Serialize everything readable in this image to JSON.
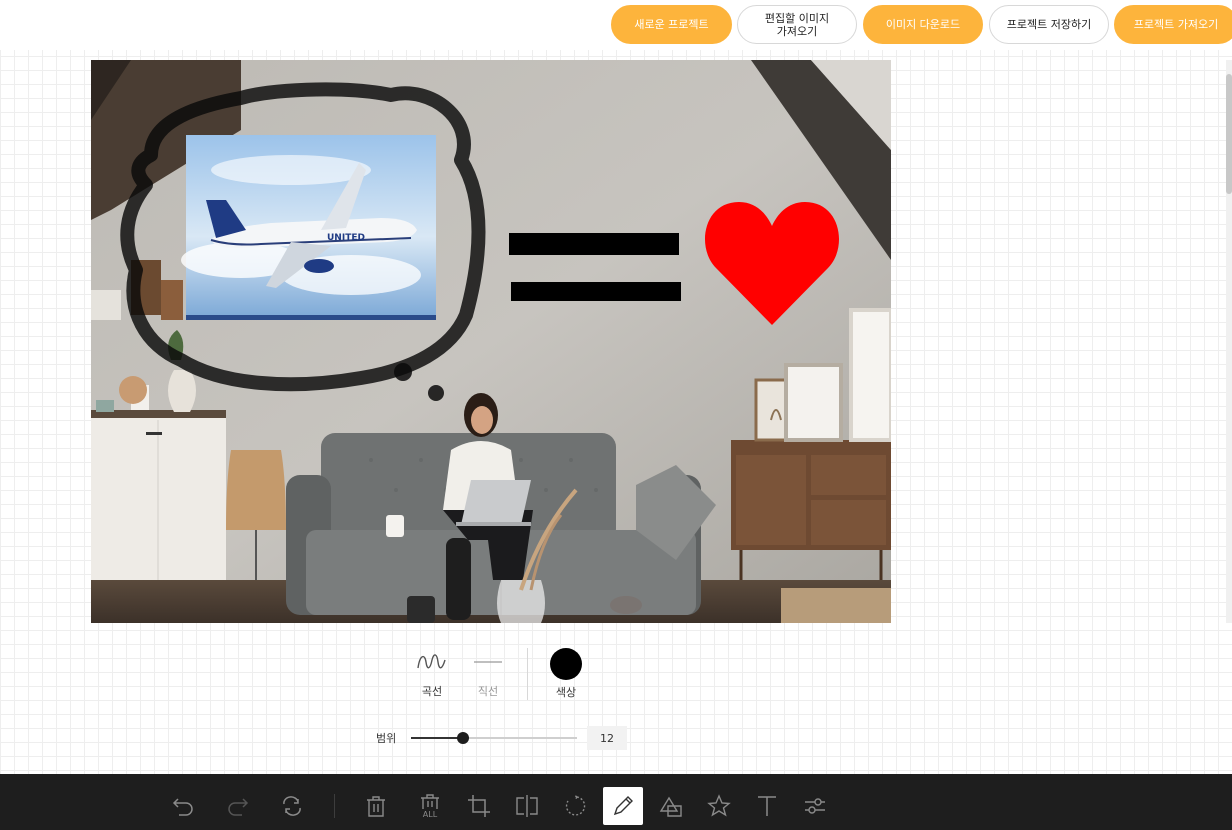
{
  "header": {
    "buttons": [
      {
        "label": "새로운 프로젝트",
        "style": "primary"
      },
      {
        "label": "편집할 이미지\n가져오기",
        "style": "secondary"
      },
      {
        "label": "이미지 다운로드",
        "style": "primary"
      },
      {
        "label": "프로젝트 저장하기",
        "style": "secondary"
      },
      {
        "label": "프로젝트 가져오기",
        "style": "primary"
      }
    ]
  },
  "canvas": {
    "airplane_logo_text": "UNITED",
    "equals_sign": "=",
    "heart_color": "#ff0000"
  },
  "draw_menu": {
    "free_label": "곡선",
    "line_label": "직선",
    "color_label": "색상",
    "selected_color": "#000000",
    "range_label": "범위",
    "range_value": "12",
    "range_fraction": 0.3
  },
  "toolbar": {
    "tools": [
      "undo-icon",
      "redo-icon",
      "reset-icon",
      "delete-icon",
      "delete-all-icon",
      "crop-icon",
      "flip-icon",
      "rotate-icon",
      "draw-icon",
      "shape-icon",
      "icon-icon",
      "text-icon",
      "filter-icon"
    ],
    "active_tool": "draw-icon",
    "delete_all_caption": "ALL"
  },
  "colors": {
    "accent": "#fdb43c",
    "toolbar_bg": "#1e1e1e",
    "icon_color": "#8a8a8a"
  }
}
